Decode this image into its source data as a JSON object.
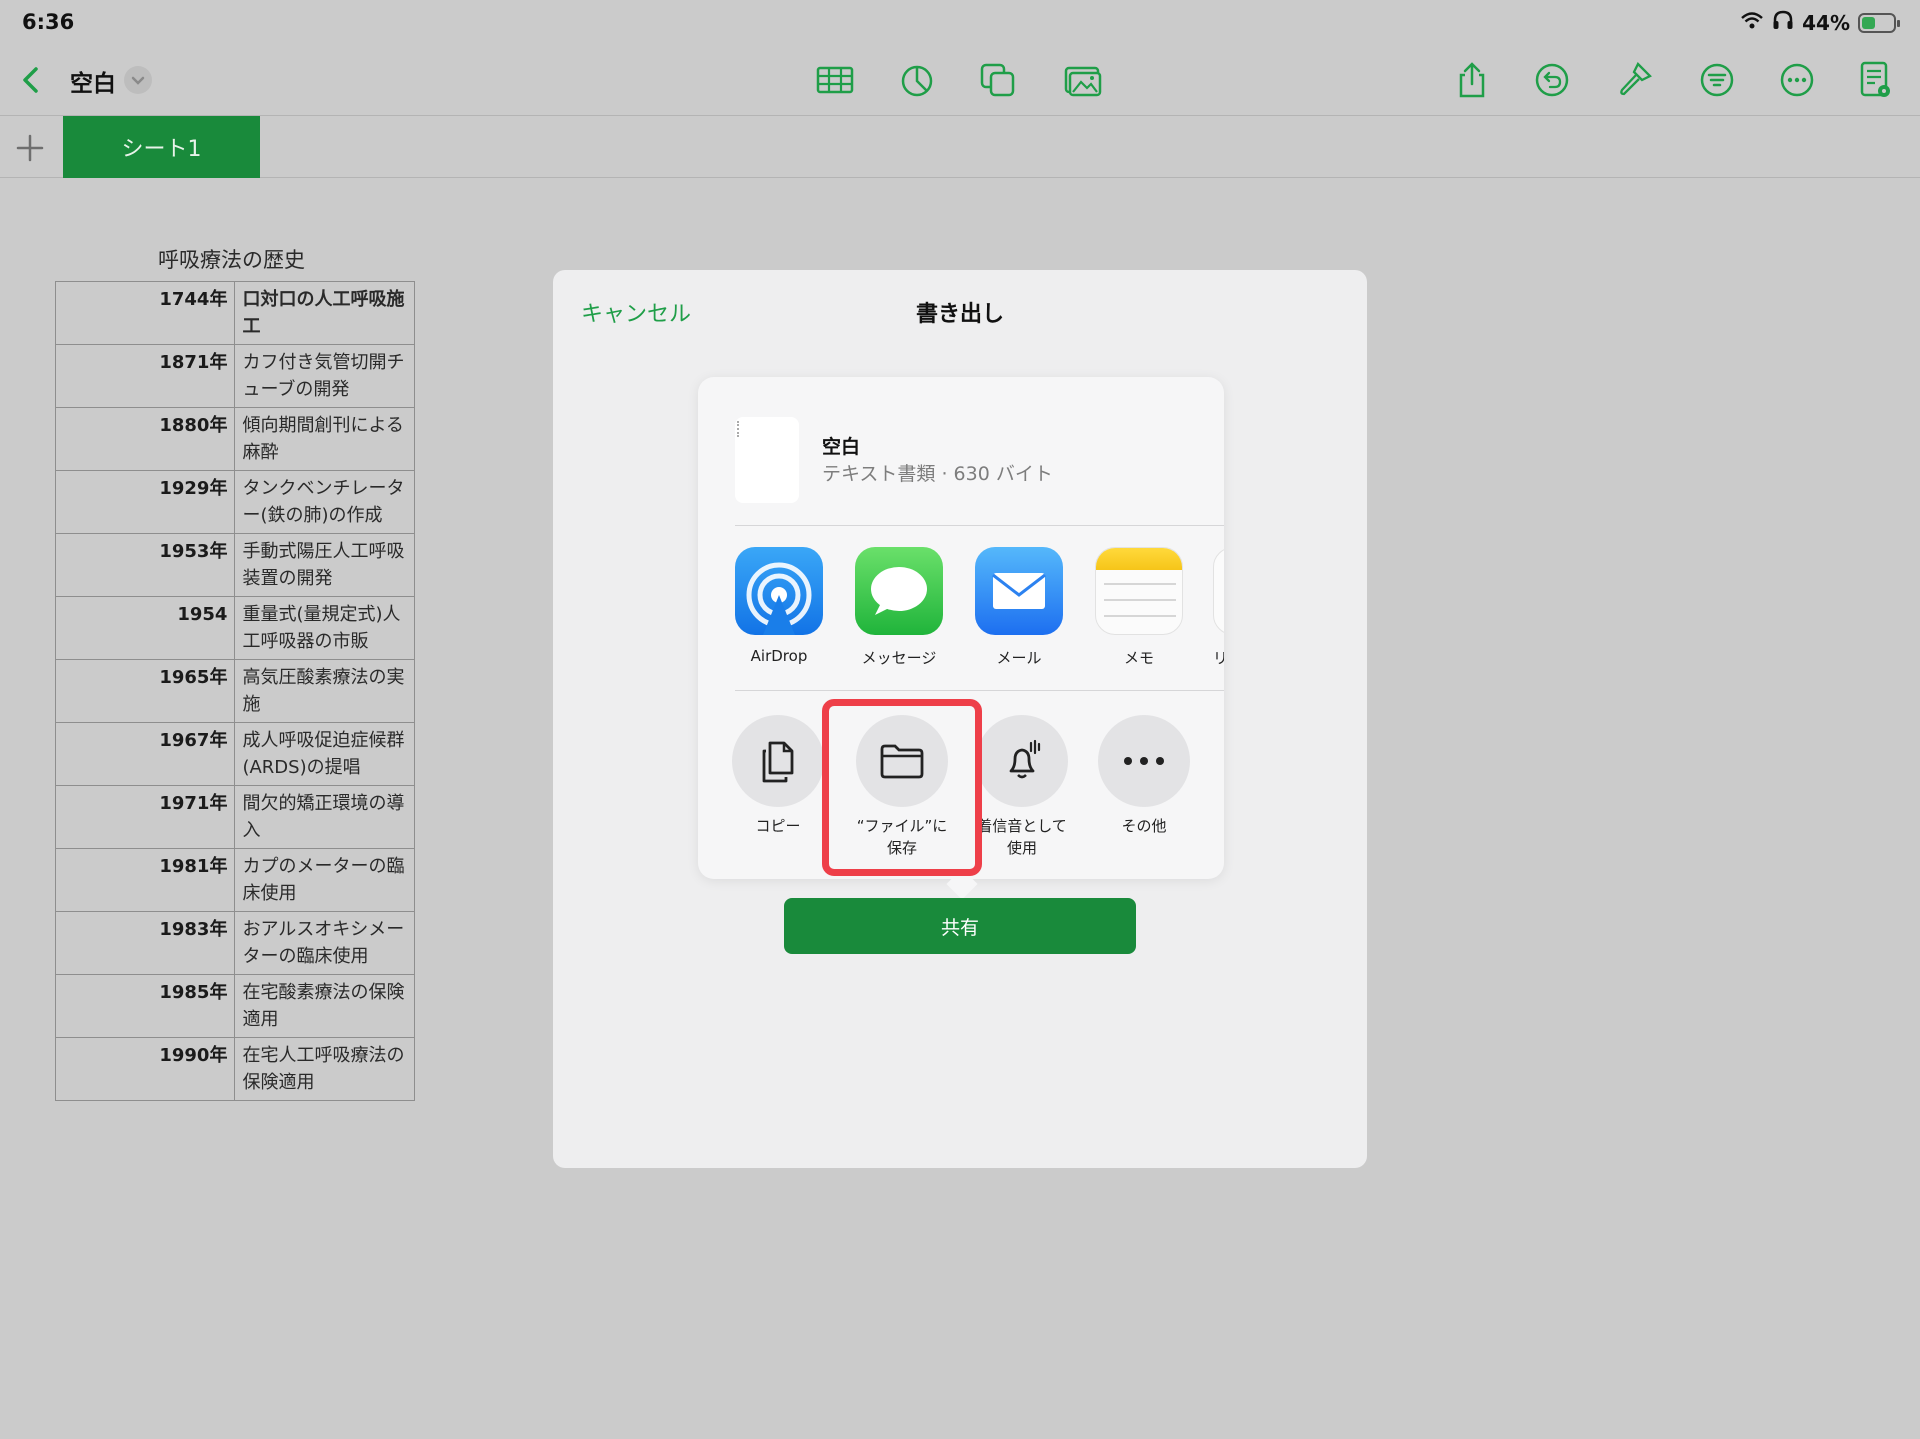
{
  "status_bar": {
    "time": "6:36",
    "battery_percent": "44%"
  },
  "toolbar": {
    "title": "空白",
    "icons": [
      "table-icon",
      "chart-icon",
      "shape-icon",
      "media-icon",
      "share-icon",
      "undo-icon",
      "format-brush-icon",
      "filter-icon",
      "more-icon",
      "document-setup-icon"
    ]
  },
  "sheets": {
    "active_tab": "シート1"
  },
  "table": {
    "title": "呼吸療法の歴史",
    "rows": [
      {
        "year": "1744年",
        "event": "口対口の人工呼吸施工"
      },
      {
        "year": "1871年",
        "event": "カフ付き気管切開チューブの開発"
      },
      {
        "year": "1880年",
        "event": "傾向期間創刊による麻酔"
      },
      {
        "year": "1929年",
        "event": "タンクベンチレーター(鉄の肺)の作成"
      },
      {
        "year": "1953年",
        "event": "手動式陽圧人工呼吸装置の開発"
      },
      {
        "year": "1954",
        "event": "重量式(量規定式)人工呼吸器の市販"
      },
      {
        "year": "1965年",
        "event": "高気圧酸素療法の実施"
      },
      {
        "year": "1967年",
        "event": "成人呼吸促迫症候群(ARDS)の提唱"
      },
      {
        "year": "1971年",
        "event": "間欠的矯正環境の導入"
      },
      {
        "year": "1981年",
        "event": "カプのメーターの臨床使用"
      },
      {
        "year": "1983年",
        "event": "おアルスオキシメーターの臨床使用"
      },
      {
        "year": "1985年",
        "event": "在宅酸素療法の保険適用"
      },
      {
        "year": "1990年",
        "event": "在宅人工呼吸療法の保険適用"
      }
    ]
  },
  "dialog": {
    "cancel_label": "キャンセル",
    "title": "書き出し",
    "file": {
      "name": "空白",
      "meta": "テキスト書類 · 630 バイト"
    },
    "apps": [
      {
        "label": "AirDrop",
        "icon": "airdrop-icon"
      },
      {
        "label": "メッセージ",
        "icon": "messages-icon"
      },
      {
        "label": "メール",
        "icon": "mail-icon"
      },
      {
        "label": "メモ",
        "icon": "notes-icon"
      },
      {
        "label": "リ",
        "icon": "reminders-icon"
      }
    ],
    "actions": [
      {
        "label": "コピー",
        "icon": "copy-icon"
      },
      {
        "label": "“ファイル”に保存",
        "icon": "folder-icon"
      },
      {
        "label": "着信音として使用",
        "icon": "bell-icon"
      },
      {
        "label": "その他",
        "icon": "more-icon"
      }
    ],
    "share_label": "共有",
    "colors": {
      "accent": "#198a3b",
      "cancel": "#1f9e48",
      "highlight": "#ee3f49"
    }
  }
}
